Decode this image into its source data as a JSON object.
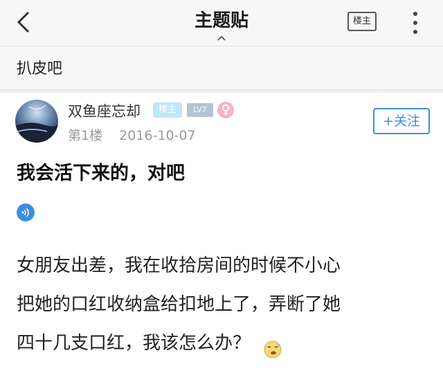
{
  "topbar": {
    "title": "主题贴",
    "back_icon": "chevron-left-icon",
    "louzhu_button": "楼主",
    "more_icon": "vertical-ellipsis-icon"
  },
  "forum": {
    "name": "扒皮吧"
  },
  "post": {
    "author": "双鱼座忘却",
    "badge_louzhu": "楼主",
    "badge_level": "LV7",
    "gender_icon": "female-icon",
    "floor": "第1楼",
    "date": "2016-10-07",
    "follow_label": "+关注",
    "title": "我会活下来的，对吧",
    "audio_icon": "audio-wave-icon",
    "content_lines": [
      "女朋友出差，我在收拾房间的时候不小心",
      "把她的口红收纳盒给扣地上了，弄断了她",
      "四十几支口红，我该怎么办？"
    ],
    "emoji": "sweating-emoji-icon"
  },
  "colors": {
    "accent_blue": "#3d8ee0",
    "badge_louzhu_bg": "#bde6ff",
    "badge_level_bg": "#b5c4d4",
    "female_pink": "#f7b2c5"
  }
}
